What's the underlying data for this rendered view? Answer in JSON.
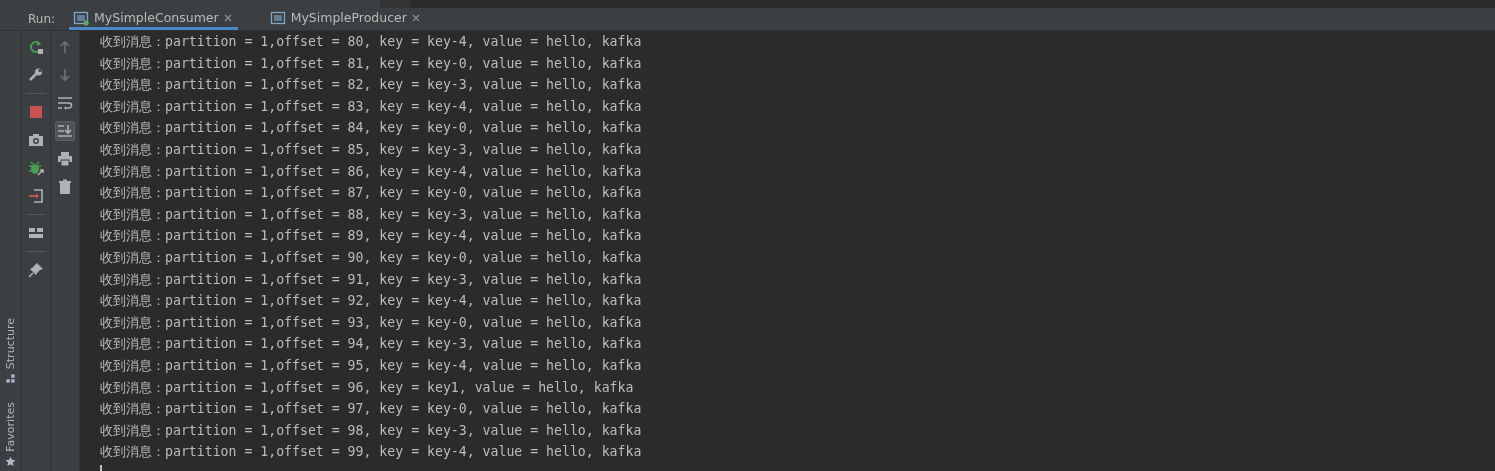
{
  "run_panel": {
    "label": "Run:",
    "tabs": [
      {
        "label": "MySimpleConsumer",
        "selected": true,
        "running": true
      },
      {
        "label": "MySimpleProducer",
        "selected": false,
        "running": false
      }
    ]
  },
  "side_stripe": [
    "Structure",
    "Favorites"
  ],
  "toolbar_main": [
    {
      "kind": "rerun"
    },
    {
      "kind": "wrench"
    },
    {
      "kind": "divider"
    },
    {
      "kind": "stop"
    },
    {
      "kind": "camera"
    },
    {
      "kind": "debug"
    },
    {
      "kind": "exit"
    },
    {
      "kind": "divider"
    },
    {
      "kind": "layout"
    },
    {
      "kind": "divider"
    },
    {
      "kind": "pin"
    }
  ],
  "toolbar_output": [
    {
      "kind": "up",
      "disabled": true,
      "selected": false
    },
    {
      "kind": "down",
      "disabled": true,
      "selected": false
    },
    {
      "kind": "wrap",
      "disabled": false,
      "selected": false
    },
    {
      "kind": "scroll-end",
      "disabled": false,
      "selected": true
    },
    {
      "kind": "print",
      "disabled": false,
      "selected": false
    },
    {
      "kind": "trash",
      "disabled": false,
      "selected": false
    }
  ],
  "console_lines": [
    "收到消息：partition = 1,offset = 80, key = key-4, value = hello, kafka",
    "收到消息：partition = 1,offset = 81, key = key-0, value = hello, kafka",
    "收到消息：partition = 1,offset = 82, key = key-3, value = hello, kafka",
    "收到消息：partition = 1,offset = 83, key = key-4, value = hello, kafka",
    "收到消息：partition = 1,offset = 84, key = key-0, value = hello, kafka",
    "收到消息：partition = 1,offset = 85, key = key-3, value = hello, kafka",
    "收到消息：partition = 1,offset = 86, key = key-4, value = hello, kafka",
    "收到消息：partition = 1,offset = 87, key = key-0, value = hello, kafka",
    "收到消息：partition = 1,offset = 88, key = key-3, value = hello, kafka",
    "收到消息：partition = 1,offset = 89, key = key-4, value = hello, kafka",
    "收到消息：partition = 1,offset = 90, key = key-0, value = hello, kafka",
    "收到消息：partition = 1,offset = 91, key = key-3, value = hello, kafka",
    "收到消息：partition = 1,offset = 92, key = key-4, value = hello, kafka",
    "收到消息：partition = 1,offset = 93, key = key-0, value = hello, kafka",
    "收到消息：partition = 1,offset = 94, key = key-3, value = hello, kafka",
    "收到消息：partition = 1,offset = 95, key = key-4, value = hello, kafka",
    "收到消息：partition = 1,offset = 96, key = key1, value = hello, kafka",
    "收到消息：partition = 1,offset = 97, key = key-0, value = hello, kafka",
    "收到消息：partition = 1,offset = 98, key = key-3, value = hello, kafka",
    "收到消息：partition = 1,offset = 99, key = key-4, value = hello, kafka"
  ]
}
